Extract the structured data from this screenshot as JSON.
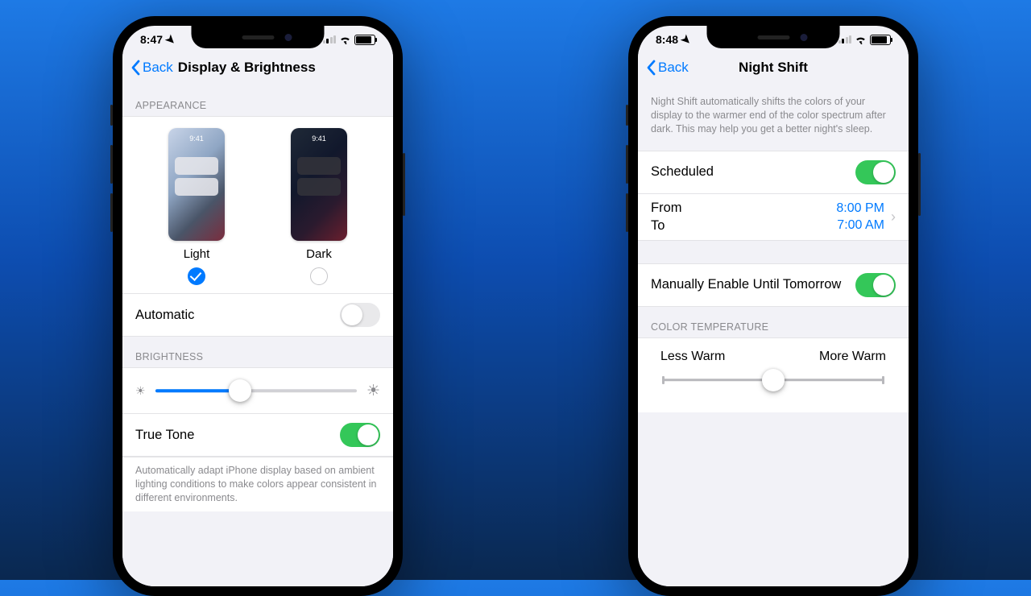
{
  "phone1": {
    "status": {
      "time": "8:47"
    },
    "nav": {
      "back": "Back",
      "title": "Display & Brightness"
    },
    "appearance": {
      "header": "APPEARANCE",
      "preview_clock": "9:41",
      "light_label": "Light",
      "dark_label": "Dark",
      "selected": "light"
    },
    "automatic": {
      "label": "Automatic",
      "on": false
    },
    "brightness": {
      "header": "BRIGHTNESS",
      "value_pct": 42
    },
    "truetone": {
      "label": "True Tone",
      "on": true,
      "desc": "Automatically adapt iPhone display based on ambient lighting conditions to make colors appear consistent in different environments."
    }
  },
  "phone2": {
    "status": {
      "time": "8:48"
    },
    "nav": {
      "back": "Back",
      "title": "Night Shift"
    },
    "intro": "Night Shift automatically shifts the colors of your display to the warmer end of the color spectrum after dark. This may help you get a better night's sleep.",
    "scheduled": {
      "label": "Scheduled",
      "on": true
    },
    "schedule": {
      "from_label": "From",
      "from_value": "8:00 PM",
      "to_label": "To",
      "to_value": "7:00 AM"
    },
    "manual": {
      "label": "Manually Enable Until Tomorrow",
      "on": true
    },
    "colortemp": {
      "header": "COLOR TEMPERATURE",
      "less": "Less Warm",
      "more": "More Warm",
      "value_pct": 50
    }
  }
}
